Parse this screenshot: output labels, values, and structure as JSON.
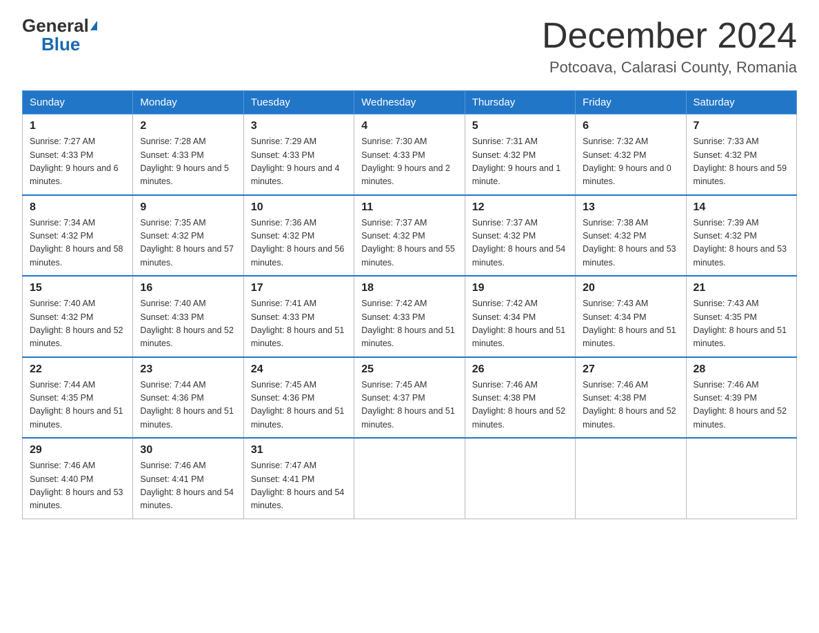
{
  "header": {
    "logo_general": "General",
    "logo_blue": "Blue",
    "month_title": "December 2024",
    "location": "Potcoava, Calarasi County, Romania"
  },
  "columns": [
    "Sunday",
    "Monday",
    "Tuesday",
    "Wednesday",
    "Thursday",
    "Friday",
    "Saturday"
  ],
  "weeks": [
    [
      {
        "day": "1",
        "sunrise": "7:27 AM",
        "sunset": "4:33 PM",
        "daylight": "9 hours and 6 minutes."
      },
      {
        "day": "2",
        "sunrise": "7:28 AM",
        "sunset": "4:33 PM",
        "daylight": "9 hours and 5 minutes."
      },
      {
        "day": "3",
        "sunrise": "7:29 AM",
        "sunset": "4:33 PM",
        "daylight": "9 hours and 4 minutes."
      },
      {
        "day": "4",
        "sunrise": "7:30 AM",
        "sunset": "4:33 PM",
        "daylight": "9 hours and 2 minutes."
      },
      {
        "day": "5",
        "sunrise": "7:31 AM",
        "sunset": "4:32 PM",
        "daylight": "9 hours and 1 minute."
      },
      {
        "day": "6",
        "sunrise": "7:32 AM",
        "sunset": "4:32 PM",
        "daylight": "9 hours and 0 minutes."
      },
      {
        "day": "7",
        "sunrise": "7:33 AM",
        "sunset": "4:32 PM",
        "daylight": "8 hours and 59 minutes."
      }
    ],
    [
      {
        "day": "8",
        "sunrise": "7:34 AM",
        "sunset": "4:32 PM",
        "daylight": "8 hours and 58 minutes."
      },
      {
        "day": "9",
        "sunrise": "7:35 AM",
        "sunset": "4:32 PM",
        "daylight": "8 hours and 57 minutes."
      },
      {
        "day": "10",
        "sunrise": "7:36 AM",
        "sunset": "4:32 PM",
        "daylight": "8 hours and 56 minutes."
      },
      {
        "day": "11",
        "sunrise": "7:37 AM",
        "sunset": "4:32 PM",
        "daylight": "8 hours and 55 minutes."
      },
      {
        "day": "12",
        "sunrise": "7:37 AM",
        "sunset": "4:32 PM",
        "daylight": "8 hours and 54 minutes."
      },
      {
        "day": "13",
        "sunrise": "7:38 AM",
        "sunset": "4:32 PM",
        "daylight": "8 hours and 53 minutes."
      },
      {
        "day": "14",
        "sunrise": "7:39 AM",
        "sunset": "4:32 PM",
        "daylight": "8 hours and 53 minutes."
      }
    ],
    [
      {
        "day": "15",
        "sunrise": "7:40 AM",
        "sunset": "4:32 PM",
        "daylight": "8 hours and 52 minutes."
      },
      {
        "day": "16",
        "sunrise": "7:40 AM",
        "sunset": "4:33 PM",
        "daylight": "8 hours and 52 minutes."
      },
      {
        "day": "17",
        "sunrise": "7:41 AM",
        "sunset": "4:33 PM",
        "daylight": "8 hours and 51 minutes."
      },
      {
        "day": "18",
        "sunrise": "7:42 AM",
        "sunset": "4:33 PM",
        "daylight": "8 hours and 51 minutes."
      },
      {
        "day": "19",
        "sunrise": "7:42 AM",
        "sunset": "4:34 PM",
        "daylight": "8 hours and 51 minutes."
      },
      {
        "day": "20",
        "sunrise": "7:43 AM",
        "sunset": "4:34 PM",
        "daylight": "8 hours and 51 minutes."
      },
      {
        "day": "21",
        "sunrise": "7:43 AM",
        "sunset": "4:35 PM",
        "daylight": "8 hours and 51 minutes."
      }
    ],
    [
      {
        "day": "22",
        "sunrise": "7:44 AM",
        "sunset": "4:35 PM",
        "daylight": "8 hours and 51 minutes."
      },
      {
        "day": "23",
        "sunrise": "7:44 AM",
        "sunset": "4:36 PM",
        "daylight": "8 hours and 51 minutes."
      },
      {
        "day": "24",
        "sunrise": "7:45 AM",
        "sunset": "4:36 PM",
        "daylight": "8 hours and 51 minutes."
      },
      {
        "day": "25",
        "sunrise": "7:45 AM",
        "sunset": "4:37 PM",
        "daylight": "8 hours and 51 minutes."
      },
      {
        "day": "26",
        "sunrise": "7:46 AM",
        "sunset": "4:38 PM",
        "daylight": "8 hours and 52 minutes."
      },
      {
        "day": "27",
        "sunrise": "7:46 AM",
        "sunset": "4:38 PM",
        "daylight": "8 hours and 52 minutes."
      },
      {
        "day": "28",
        "sunrise": "7:46 AM",
        "sunset": "4:39 PM",
        "daylight": "8 hours and 52 minutes."
      }
    ],
    [
      {
        "day": "29",
        "sunrise": "7:46 AM",
        "sunset": "4:40 PM",
        "daylight": "8 hours and 53 minutes."
      },
      {
        "day": "30",
        "sunrise": "7:46 AM",
        "sunset": "4:41 PM",
        "daylight": "8 hours and 54 minutes."
      },
      {
        "day": "31",
        "sunrise": "7:47 AM",
        "sunset": "4:41 PM",
        "daylight": "8 hours and 54 minutes."
      },
      null,
      null,
      null,
      null
    ]
  ],
  "labels": {
    "sunrise_prefix": "Sunrise: ",
    "sunset_prefix": "Sunset: ",
    "daylight_prefix": "Daylight: "
  }
}
